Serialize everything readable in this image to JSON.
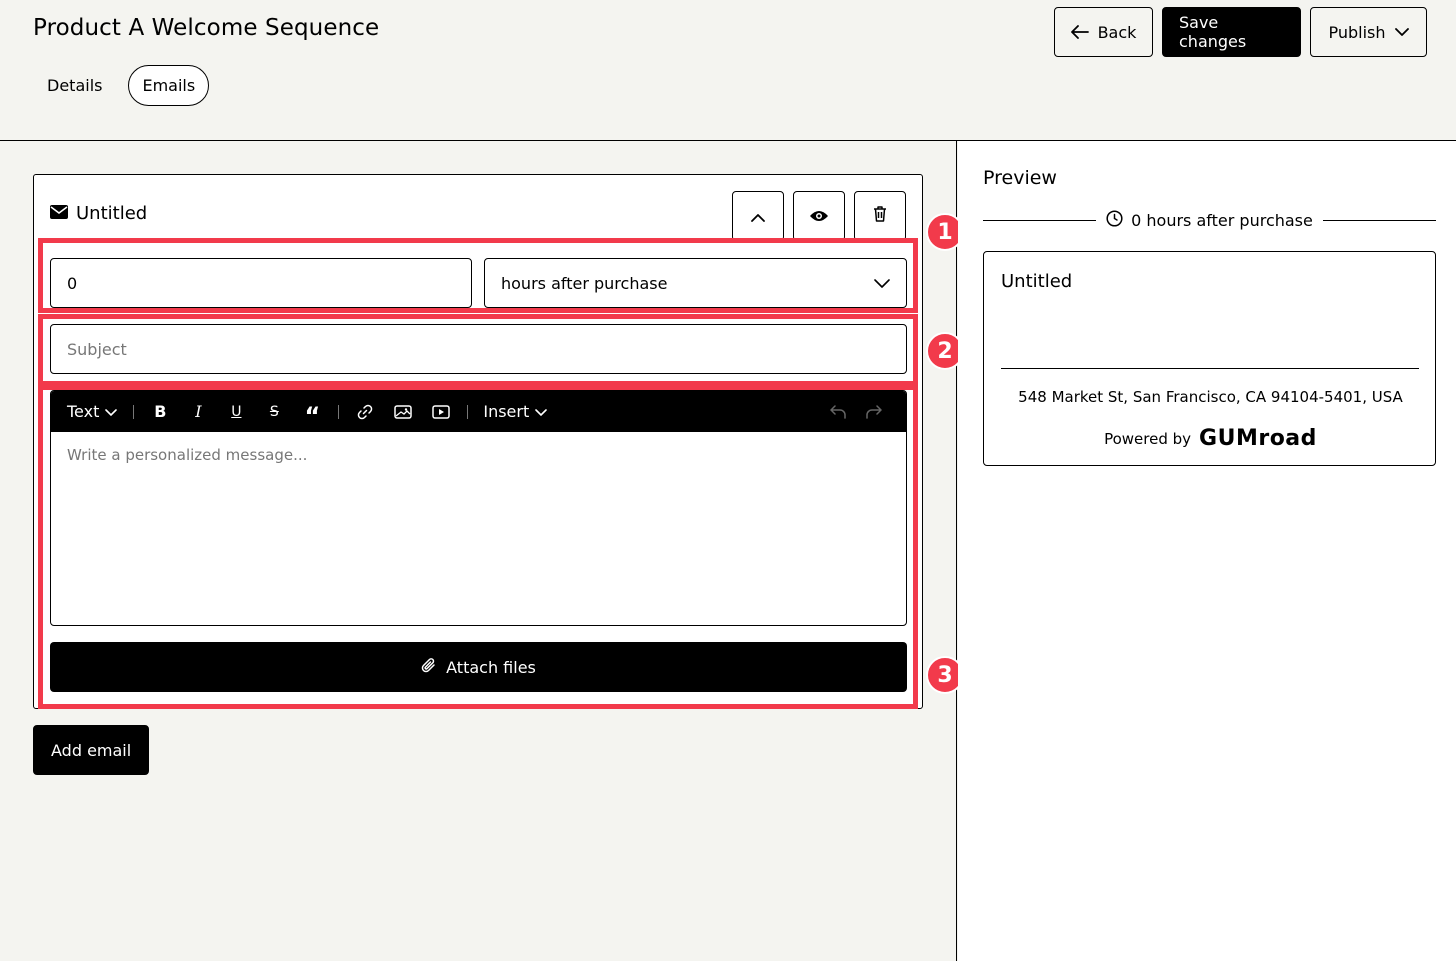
{
  "header": {
    "title": "Product A Welcome Sequence",
    "tabs": [
      {
        "label": "Details",
        "active": false
      },
      {
        "label": "Emails",
        "active": true
      }
    ],
    "back_label": "Back",
    "save_label": "Save changes",
    "publish_label": "Publish"
  },
  "email": {
    "title": "Untitled",
    "delay_value": "0",
    "delay_unit": "hours after purchase",
    "subject_placeholder": "Subject",
    "toolbar": {
      "text_label": "Text",
      "bold": "B",
      "italic": "I",
      "underline": "U",
      "strike": "S",
      "quote": "“",
      "insert_label": "Insert"
    },
    "body_placeholder": "Write a personalized message...",
    "attach_label": "Attach files"
  },
  "add_email_label": "Add email",
  "annotations": {
    "one": "1",
    "two": "2",
    "three": "3"
  },
  "preview": {
    "title": "Preview",
    "timing": "0 hours after purchase",
    "subject": "Untitled",
    "address": "548 Market St, San Francisco, CA 94104-5401, USA",
    "powered_by": "Powered by",
    "brand": "GUMroad"
  },
  "colors": {
    "accent_highlight": "#f23a4b",
    "background": "#f4f4f0",
    "primary": "#000000"
  }
}
